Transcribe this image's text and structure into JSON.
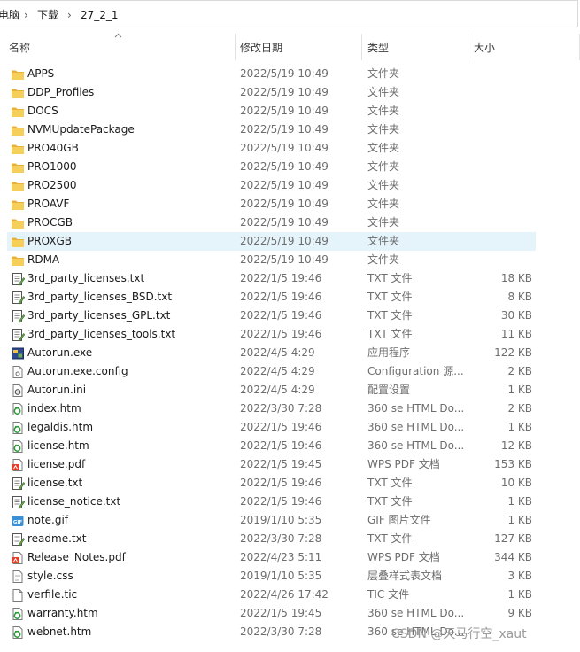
{
  "breadcrumb": [
    "电脑",
    "下载",
    "27_2_1"
  ],
  "columns": {
    "name": "名称",
    "date": "修改日期",
    "type": "类型",
    "size": "大小"
  },
  "rows": [
    {
      "name": "APPS",
      "date": "2022/5/19 10:49",
      "type": "文件夹",
      "size": "",
      "icon": "folder-icon"
    },
    {
      "name": "DDP_Profiles",
      "date": "2022/5/19 10:49",
      "type": "文件夹",
      "size": "",
      "icon": "folder-icon"
    },
    {
      "name": "DOCS",
      "date": "2022/5/19 10:49",
      "type": "文件夹",
      "size": "",
      "icon": "folder-icon"
    },
    {
      "name": "NVMUpdatePackage",
      "date": "2022/5/19 10:49",
      "type": "文件夹",
      "size": "",
      "icon": "folder-icon"
    },
    {
      "name": "PRO40GB",
      "date": "2022/5/19 10:49",
      "type": "文件夹",
      "size": "",
      "icon": "folder-icon"
    },
    {
      "name": "PRO1000",
      "date": "2022/5/19 10:49",
      "type": "文件夹",
      "size": "",
      "icon": "folder-icon"
    },
    {
      "name": "PRO2500",
      "date": "2022/5/19 10:49",
      "type": "文件夹",
      "size": "",
      "icon": "folder-icon"
    },
    {
      "name": "PROAVF",
      "date": "2022/5/19 10:49",
      "type": "文件夹",
      "size": "",
      "icon": "folder-icon"
    },
    {
      "name": "PROCGB",
      "date": "2022/5/19 10:49",
      "type": "文件夹",
      "size": "",
      "icon": "folder-icon"
    },
    {
      "name": "PROXGB",
      "date": "2022/5/19 10:49",
      "type": "文件夹",
      "size": "",
      "icon": "folder-icon",
      "selected": true
    },
    {
      "name": "RDMA",
      "date": "2022/5/19 10:49",
      "type": "文件夹",
      "size": "",
      "icon": "folder-icon"
    },
    {
      "name": "3rd_party_licenses.txt",
      "date": "2022/1/5 19:46",
      "type": "TXT 文件",
      "size": "18 KB",
      "icon": "text-file-icon"
    },
    {
      "name": "3rd_party_licenses_BSD.txt",
      "date": "2022/1/5 19:46",
      "type": "TXT 文件",
      "size": "8 KB",
      "icon": "text-file-icon"
    },
    {
      "name": "3rd_party_licenses_GPL.txt",
      "date": "2022/1/5 19:46",
      "type": "TXT 文件",
      "size": "30 KB",
      "icon": "text-file-icon"
    },
    {
      "name": "3rd_party_licenses_tools.txt",
      "date": "2022/1/5 19:46",
      "type": "TXT 文件",
      "size": "11 KB",
      "icon": "text-file-icon"
    },
    {
      "name": "Autorun.exe",
      "date": "2022/4/5 4:29",
      "type": "应用程序",
      "size": "122 KB",
      "icon": "exe-icon"
    },
    {
      "name": "Autorun.exe.config",
      "date": "2022/4/5 4:29",
      "type": "Configuration 源...",
      "size": "2 KB",
      "icon": "generic-file-icon"
    },
    {
      "name": "Autorun.ini",
      "date": "2022/4/5 4:29",
      "type": "配置设置",
      "size": "1 KB",
      "icon": "ini-file-icon"
    },
    {
      "name": "index.htm",
      "date": "2022/3/30 7:28",
      "type": "360 se HTML Do...",
      "size": "2 KB",
      "icon": "html-file-icon"
    },
    {
      "name": "legaldis.htm",
      "date": "2022/1/5 19:46",
      "type": "360 se HTML Do...",
      "size": "1 KB",
      "icon": "html-file-icon"
    },
    {
      "name": "license.htm",
      "date": "2022/1/5 19:46",
      "type": "360 se HTML Do...",
      "size": "12 KB",
      "icon": "html-file-icon"
    },
    {
      "name": "license.pdf",
      "date": "2022/1/5 19:45",
      "type": "WPS PDF 文档",
      "size": "153 KB",
      "icon": "pdf-file-icon"
    },
    {
      "name": "license.txt",
      "date": "2022/1/5 19:46",
      "type": "TXT 文件",
      "size": "10 KB",
      "icon": "text-file-icon"
    },
    {
      "name": "license_notice.txt",
      "date": "2022/1/5 19:46",
      "type": "TXT 文件",
      "size": "1 KB",
      "icon": "text-file-icon"
    },
    {
      "name": "note.gif",
      "date": "2019/1/10 5:35",
      "type": "GIF 图片文件",
      "size": "1 KB",
      "icon": "gif-file-icon"
    },
    {
      "name": "readme.txt",
      "date": "2022/3/30 7:28",
      "type": "TXT 文件",
      "size": "127 KB",
      "icon": "text-file-icon"
    },
    {
      "name": "Release_Notes.pdf",
      "date": "2022/4/23 5:11",
      "type": "WPS PDF 文档",
      "size": "344 KB",
      "icon": "pdf-file-icon"
    },
    {
      "name": "style.css",
      "date": "2019/1/10 5:35",
      "type": "层叠样式表文档",
      "size": "3 KB",
      "icon": "css-file-icon"
    },
    {
      "name": "verfile.tic",
      "date": "2022/4/26 17:42",
      "type": "TIC 文件",
      "size": "1 KB",
      "icon": "blank-file-icon"
    },
    {
      "name": "warranty.htm",
      "date": "2022/1/5 19:45",
      "type": "360 se HTML Do...",
      "size": "9 KB",
      "icon": "html-file-icon"
    },
    {
      "name": "webnet.htm",
      "date": "2022/3/30 7:28",
      "type": "360 se HTML Do...",
      "size": "",
      "icon": "html-file-icon"
    }
  ],
  "watermark": "CSDN @天马行空_xaut",
  "colors": {
    "selected_row": "#e5f3fb",
    "folder": "#f3c44a",
    "accent": "#1f7bd1"
  }
}
